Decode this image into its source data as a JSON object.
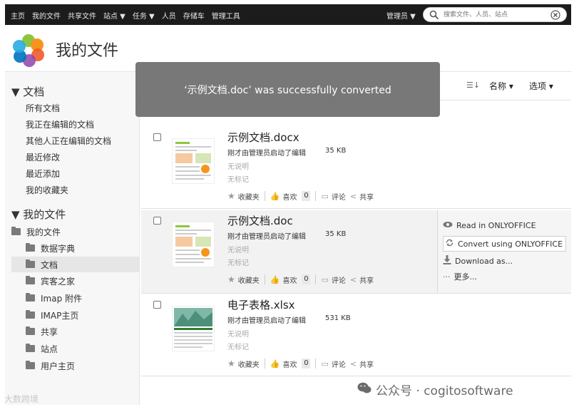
{
  "topbar": {
    "nav": [
      "主页",
      "我的文件",
      "共享文件",
      "站点 ▼",
      "任务 ▼",
      "人员",
      "存储车",
      "管理工具"
    ],
    "user_menu": "管理员 ▼",
    "search_placeholder": "搜索文件、人员、站点"
  },
  "header": {
    "title": "我的文件"
  },
  "sidebar": {
    "documents_title": "▼ 文档",
    "document_links": [
      "所有文档",
      "我正在编辑的文档",
      "其他人正在编辑的文档",
      "最近修改",
      "最近添加",
      "我的收藏夹"
    ],
    "files_title": "▼ 我的文件",
    "tree": {
      "root": "我的文件",
      "folders": [
        "数据字典",
        "文档",
        "宾客之家",
        "Imap 附件",
        "IMAP主页",
        "共享",
        "站点",
        "用户主页"
      ],
      "selected": "文档"
    }
  },
  "toolbar": {
    "sort_label": "名称 ▾",
    "options_label": "选项 ▾"
  },
  "notification": "‘示例文档.doc’ was successfully converted",
  "documents": [
    {
      "name": "示例文档.docx",
      "meta": "刚才由管理员启动了编辑",
      "size": "35 KB",
      "description": "无说明",
      "tags": "无标记",
      "favorite": "收藏夹",
      "like": "喜欢",
      "like_count": "0",
      "comment": "评论",
      "share": "共享"
    },
    {
      "name": "示例文档.doc",
      "meta": "刚才由管理员启动了编辑",
      "size": "35 KB",
      "description": "无说明",
      "tags": "无标记",
      "favorite": "收藏夹",
      "like": "喜欢",
      "like_count": "0",
      "comment": "评论",
      "share": "共享"
    },
    {
      "name": "电子表格.xlsx",
      "meta": "刚才由管理员启动了编辑",
      "size": "531 KB",
      "description": "无说明",
      "tags": "无标记",
      "favorite": "收藏夹",
      "like": "喜欢",
      "like_count": "0",
      "comment": "评论",
      "share": "共享"
    }
  ],
  "row_actions": {
    "read": "Read in ONLYOFFICE",
    "convert": "Convert using ONLYOFFICE",
    "download": "Download as...",
    "more": "更多..."
  },
  "watermarks": {
    "left": "大数跨境",
    "right": "公众号 · cogitosoftware"
  }
}
